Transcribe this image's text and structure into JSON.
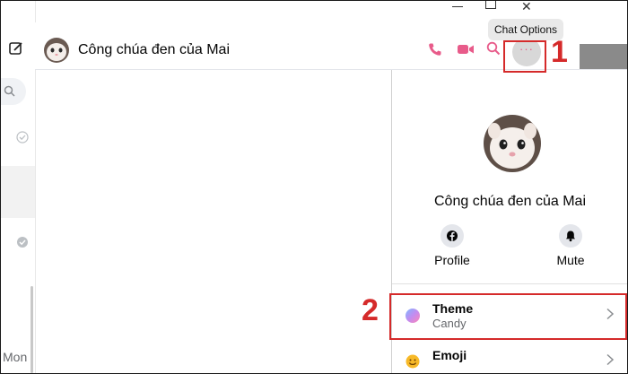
{
  "window": {
    "close_glyph": "✕"
  },
  "tooltip": {
    "text": "Chat Options"
  },
  "left_column": {
    "bottom_text": "Mon"
  },
  "header": {
    "contact_name": "Công chúa đen của Mai",
    "options_glyph": "···"
  },
  "annotations": {
    "first": "1",
    "second": "2"
  },
  "panel": {
    "name": "Công chúa đen của Mai",
    "actions": [
      {
        "label": "Profile",
        "icon": "facebook-icon"
      },
      {
        "label": "Mute",
        "icon": "bell-icon"
      }
    ],
    "items": [
      {
        "title": "Theme",
        "subtitle": "Candy",
        "icon": "theme-gradient-icon"
      },
      {
        "title": "Emoji",
        "icon": "emoji-icon"
      }
    ]
  },
  "colors": {
    "accent": "#e85b8a",
    "annotation": "#d52a2a",
    "panel_bg": "#ffffff",
    "action_circle": "#e4e6eb"
  }
}
